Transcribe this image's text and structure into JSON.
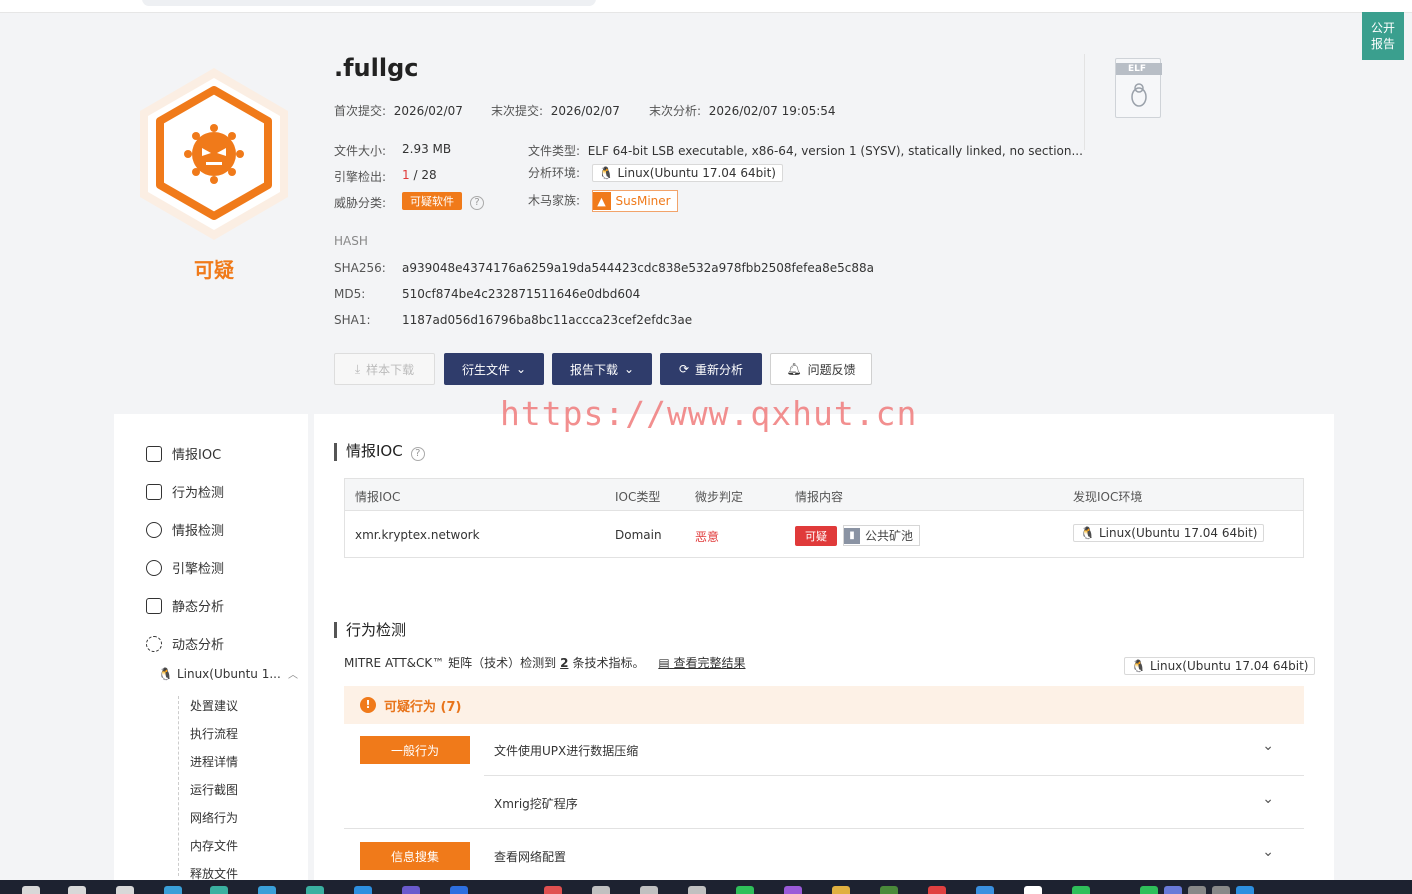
{
  "public_report": "公开\n报告",
  "verdict": "可疑",
  "file": {
    "title": ".fullgc",
    "first_submit_label": "首次提交:",
    "first_submit": "2026/02/07",
    "last_submit_label": "末次提交:",
    "last_submit": "2026/02/07",
    "last_analysis_label": "末次分析:",
    "last_analysis": "2026/02/07 19:05:54",
    "size_label": "文件大小:",
    "size": "2.93 MB",
    "type_label": "文件类型:",
    "type": "ELF 64-bit LSB executable, x86-64, version 1 (SYSV), statically linked, no section...",
    "engine_label": "引擎检出:",
    "engine_hits": "1",
    "engine_total": "/ 28",
    "env_label": "分析环境:",
    "env": "Linux(Ubuntu 17.04 64bit)",
    "threat_label": "威胁分类:",
    "threat": "可疑软件",
    "family_label": "木马家族:",
    "family": "SusMiner",
    "elf_badge": "ELF"
  },
  "hash": {
    "heading": "HASH",
    "sha256_label": "SHA256:",
    "sha256": "a939048e4374176a6259a19da544423cdc838e532a978fbb2508fefea8e5c88a",
    "md5_label": "MD5:",
    "md5": "510cf874be4c232871511646e0dbd604",
    "sha1_label": "SHA1:",
    "sha1": "1187ad056d16796ba8bc11accca23cef2efdc3ae"
  },
  "actions": {
    "sample_download": "样本下载",
    "derived_files": "衍生文件",
    "report_download": "报告下载",
    "reanalyze": "重新分析",
    "feedback": "问题反馈"
  },
  "watermark": "https://www.qxhut.cn",
  "sidebar": {
    "items": [
      "情报IOC",
      "行为检测",
      "情报检测",
      "引擎检测",
      "静态分析",
      "动态分析"
    ],
    "env_head": "Linux(Ubuntu 1...",
    "sub_items": [
      "处置建议",
      "执行流程",
      "进程详情",
      "运行截图",
      "网络行为",
      "内存文件",
      "释放文件"
    ]
  },
  "ioc": {
    "title": "情报IOC",
    "headers": [
      "情报IOC",
      "IOC类型",
      "微步判定",
      "情报内容",
      "发现IOC环境"
    ],
    "row": {
      "ioc": "xmr.kryptex.network",
      "type": "Domain",
      "verdict": "恶意",
      "tag": "可疑",
      "pool": "公共矿池",
      "env": "Linux(Ubuntu 17.04 64bit)"
    }
  },
  "behavior": {
    "title": "行为检测",
    "mitre_prefix": "MITRE ATT&CK™ 矩阵（技术）检测到",
    "mitre_count": "2",
    "mitre_suffix": "条技术指标。",
    "view_full": "查看完整结果",
    "env": "Linux(Ubuntu 17.04 64bit)",
    "suspicious_header": "可疑行为 (7)",
    "rows": [
      {
        "category": "一般行为",
        "desc": "文件使用UPX进行数据压缩"
      },
      {
        "category": "",
        "desc": "Xmrig挖矿程序"
      },
      {
        "category": "信息搜集",
        "desc": "查看网络配置"
      }
    ]
  },
  "colors": {
    "accent_orange": "#f07a1a",
    "dark_button": "#2f3c6b",
    "danger_red": "#e03a3a",
    "public_green": "#3a9f8e"
  }
}
